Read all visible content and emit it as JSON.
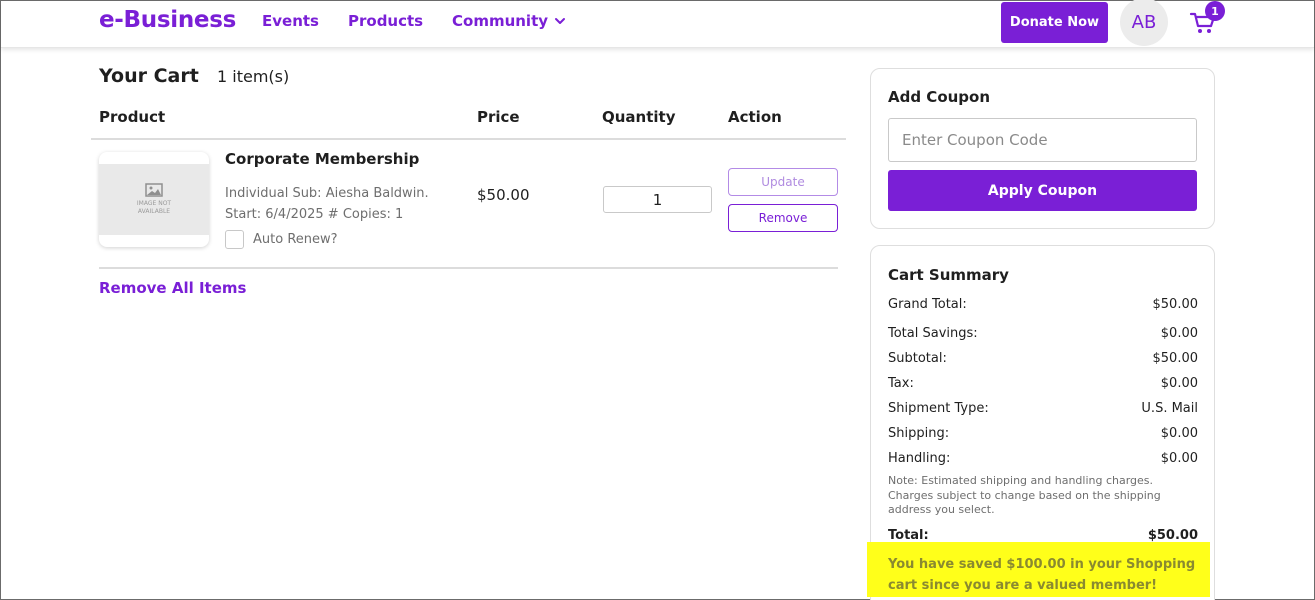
{
  "header": {
    "brand": "e-Business",
    "nav": {
      "events": "Events",
      "products": "Products",
      "community": "Community"
    },
    "donate_label": "Donate Now",
    "avatar_initials": "AB",
    "cart_count": "1"
  },
  "cart": {
    "title": "Your Cart",
    "item_count": "1 item(s)",
    "columns": {
      "product": "Product",
      "price": "Price",
      "quantity": "Quantity",
      "action": "Action"
    },
    "item": {
      "thumb_text": "IMAGE NOT AVAILABLE",
      "name": "Corporate Membership",
      "desc_line1": "Individual Sub: Aiesha Baldwin.",
      "desc_line2": "Start: 6/4/2025 # Copies: 1",
      "auto_renew_label": "Auto Renew?",
      "price": "$50.00",
      "quantity": "1",
      "update_label": "Update",
      "remove_label": "Remove"
    },
    "remove_all_label": "Remove All Items"
  },
  "coupon": {
    "title": "Add Coupon",
    "placeholder": "Enter Coupon Code",
    "apply_label": "Apply Coupon"
  },
  "summary": {
    "title": "Cart Summary",
    "rows": [
      {
        "label": "Grand Total:",
        "value": "$50.00"
      },
      {
        "label": "Total Savings:",
        "value": "$0.00"
      },
      {
        "label": "Subtotal:",
        "value": "$50.00"
      },
      {
        "label": "Tax:",
        "value": "$0.00"
      },
      {
        "label": "Shipment Type:",
        "value": "U.S. Mail"
      },
      {
        "label": "Shipping:",
        "value": "$0.00"
      },
      {
        "label": "Handling:",
        "value": "$0.00"
      }
    ],
    "note": "Note: Estimated shipping and handling charges. Charges subject to change based on the shipping address you select.",
    "total_label": "Total:",
    "total_value": "$50.00",
    "saved_message": "You have saved $100.00 in your Shopping cart since you are a valued member!"
  },
  "colors": {
    "brand": "#7a1fd6",
    "highlight": "#ffff1a"
  }
}
